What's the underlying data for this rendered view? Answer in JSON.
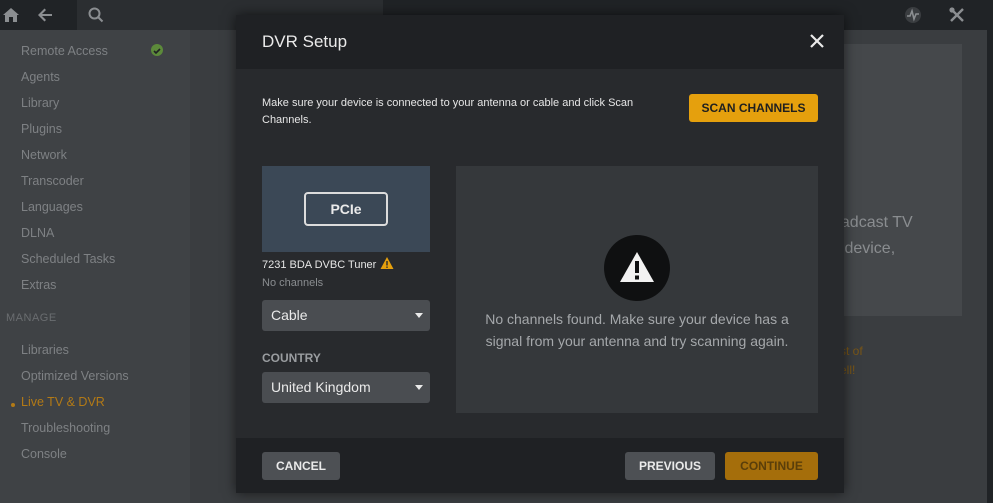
{
  "sidebar": {
    "items_top": [
      {
        "label": "Remote Access"
      },
      {
        "label": "Agents"
      },
      {
        "label": "Library"
      },
      {
        "label": "Plugins"
      },
      {
        "label": "Network"
      },
      {
        "label": "Transcoder"
      },
      {
        "label": "Languages"
      },
      {
        "label": "DLNA"
      },
      {
        "label": "Scheduled Tasks"
      },
      {
        "label": "Extras"
      }
    ],
    "manage_heading": "MANAGE",
    "items_manage": [
      {
        "label": "Libraries"
      },
      {
        "label": "Optimized Versions"
      },
      {
        "label": "Live TV & DVR"
      },
      {
        "label": "Troubleshooting"
      },
      {
        "label": "Console"
      }
    ]
  },
  "background": {
    "line1": "oadcast TV",
    "line2": "y device,",
    "orange1": "st of",
    "orange2": "ell!"
  },
  "modal": {
    "title": "DVR Setup",
    "instructions": "Make sure your device is connected to your antenna or cable and click Scan Channels.",
    "scan_button": "SCAN CHANNELS",
    "device": {
      "badge": "PCIe",
      "name": "7231 BDA DVBC Tuner",
      "status": "No channels"
    },
    "source_select": {
      "value": "Cable"
    },
    "country_label": "COUNTRY",
    "country_select": {
      "value": "United Kingdom"
    },
    "channels_message": "No channels found. Make sure your device has a signal from your antenna and try scanning again.",
    "footer": {
      "cancel": "CANCEL",
      "previous": "PREVIOUS",
      "continue": "CONTINUE"
    }
  },
  "colors": {
    "accent": "#e5a00d",
    "modal_bg": "#282a2d",
    "header_bg": "#1f2124"
  }
}
